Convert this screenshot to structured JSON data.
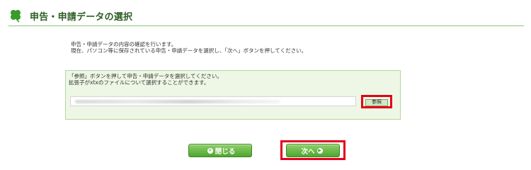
{
  "header": {
    "title": "申告・申請データの選択",
    "icon": "clover-icon"
  },
  "instructions": {
    "line1": "申告・申請データの内容の確認を行います。",
    "line2": "現在、パソコン等に保存されている申告・申請データを選択し、「次へ」ボタンを押してください。"
  },
  "panel": {
    "line1": "「参照」ボタンを押して申告・申請データを選択してください。",
    "line2": "拡張子がxtxのファイルについて選択することができます。",
    "file_value": "",
    "browse_label": "参照"
  },
  "buttons": {
    "close_label": "閉じる",
    "close_icon": "close-circle-icon",
    "next_label": "次へ",
    "next_icon": "arrow-circle-icon"
  },
  "colors": {
    "accent_green": "#4fa530",
    "title_green": "#2b5d22",
    "panel_bg": "#eef7e5",
    "highlight_red": "#e3001a"
  }
}
